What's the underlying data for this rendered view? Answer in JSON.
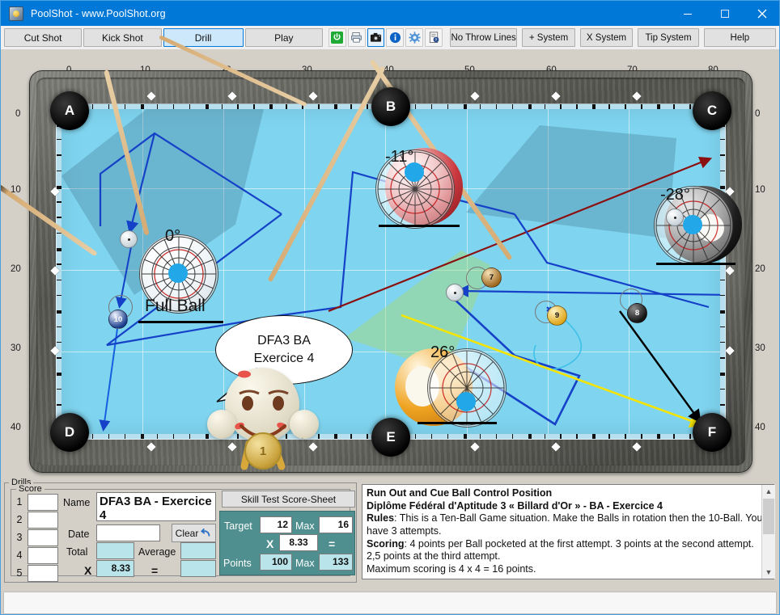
{
  "window": {
    "title": "PoolShot - www.PoolShot.org",
    "app_icon": "poolshot-logo-icon",
    "minimize": "minimize-icon",
    "maximize": "maximize-icon",
    "close": "close-icon"
  },
  "toolbar": {
    "tabs": [
      {
        "label": "Cut Shot",
        "selected": false
      },
      {
        "label": "Kick Shot",
        "selected": false
      },
      {
        "label": "Drill",
        "selected": true
      },
      {
        "label": "Play",
        "selected": false
      }
    ],
    "icons": [
      {
        "name": "power-icon",
        "glyph": "⏻",
        "color": "#1faa35",
        "active": false
      },
      {
        "name": "printer-icon",
        "glyph": "⎙",
        "color": "#5a6a7a",
        "active": false
      },
      {
        "name": "camera-icon",
        "glyph": "▣",
        "color": "#1a1a1a",
        "active": true
      },
      {
        "name": "info-icon",
        "glyph": "i",
        "color": "#0b63c5",
        "active": false
      },
      {
        "name": "settings-gear-icon",
        "glyph": "⚙",
        "color": "#3b7fc4",
        "active": false
      },
      {
        "name": "help-document-icon",
        "glyph": "?",
        "color": "#2a4f8f",
        "active": false
      }
    ],
    "systems": [
      {
        "label": "No Throw Lines"
      },
      {
        "label": "+ System"
      },
      {
        "label": "X System"
      },
      {
        "label": "Tip System"
      },
      {
        "label": "Help"
      }
    ]
  },
  "table": {
    "top_ruler": [
      "0",
      "10",
      "20",
      "30",
      "40",
      "50",
      "60",
      "70",
      "80"
    ],
    "left_ruler": [
      "0",
      "10",
      "20",
      "30",
      "40"
    ],
    "right_ruler": [
      "0",
      "10",
      "20",
      "30",
      "40"
    ],
    "pockets": [
      "A",
      "B",
      "C",
      "D",
      "E",
      "F"
    ],
    "felt_color": "#7fd4ef",
    "rail_color": "#b8dfee",
    "annotations": [
      {
        "name": "aim-angle-cue",
        "text": "0°"
      },
      {
        "name": "aim-angle-three",
        "text": "-11°"
      },
      {
        "name": "aim-angle-eight",
        "text": "-28°"
      },
      {
        "name": "aim-angle-nine",
        "text": "26°"
      },
      {
        "name": "full-ball-label",
        "text": "Full Ball"
      }
    ],
    "speech_bubble": {
      "line1": "DFA3 BA",
      "line2": "Exercice 4"
    },
    "balls": [
      {
        "name": "ball-10",
        "number": "10",
        "color": "#1b3f8f"
      },
      {
        "name": "ball-7",
        "number": "7",
        "color": "#a06a22"
      },
      {
        "name": "ball-8",
        "number": "8",
        "color": "#2a2a2a"
      },
      {
        "name": "ball-9",
        "number": "9",
        "color": "#e6b62a"
      }
    ],
    "medal_rank": "1"
  },
  "drills": {
    "group_label": "Drills",
    "score_group_label": "Score",
    "rows": [
      "1",
      "2",
      "3",
      "4",
      "5"
    ],
    "row_values": [
      "",
      "",
      "",
      "",
      ""
    ],
    "name_label": "Name",
    "name_value": "DFA3 BA - Exercice 4",
    "date_label": "Date",
    "date_value": "",
    "date_placeholder": "",
    "clear_label": "Clear",
    "clear_icon": "undo-arrow-icon",
    "total_label": "Total",
    "total_value": "",
    "average_label": "Average",
    "average_value": "",
    "multiply_symbol": "X",
    "multiplier_value": "8.33",
    "equals_symbol": "=",
    "result_value": ""
  },
  "skilltest": {
    "title": "Skill Test Score-Sheet",
    "target_label": "Target",
    "target_value": "12",
    "target_max_label": "Max",
    "target_max_value": "16",
    "multiply_symbol": "X",
    "multiplier_value": "8.33",
    "equals_symbol": "=",
    "points_label": "Points",
    "points_value": "100",
    "points_max_label": "Max",
    "points_max_value": "133",
    "panel_color": "#4f8f90"
  },
  "description": {
    "title": "Run Out and Cue Ball Control Position",
    "subtitle": "Diplôme Fédéral d'Aptitude 3 « Billard d'Or » - BA - Exercice 4",
    "rules_label": "Rules",
    "rules_text": ": This is a Ten-Ball Game situation. Make the Balls in rotation then the 10-Ball. You have 3 attempts.",
    "scoring_label": "Scoring",
    "scoring_text": ": 4 points per Ball pocketed at the first attempt. 3 points at the second attempt. 2,5 points at the third attempt.",
    "max_text": "Maximum scoring is 4 x 4 = 16 points.",
    "scroll_up": "▲",
    "scroll_down": "▼"
  }
}
